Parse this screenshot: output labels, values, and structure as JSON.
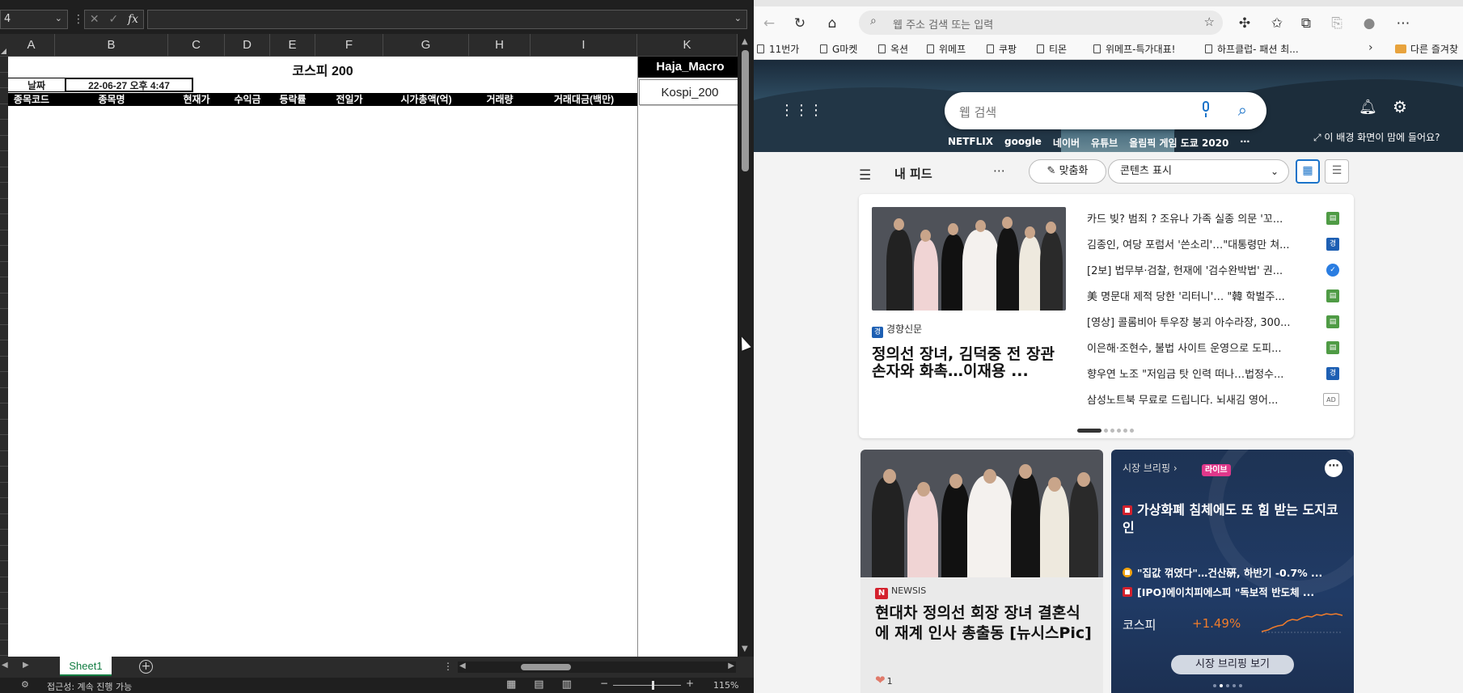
{
  "excel": {
    "name_box": "4",
    "formula_separator": "⋮",
    "formula_cancel": "✕",
    "formula_enter": "✓",
    "formula_fx": "fx",
    "formula_value": "",
    "columns": [
      "A",
      "B",
      "C",
      "D",
      "E",
      "F",
      "G",
      "H",
      "I",
      "K"
    ],
    "sheet_title": "코스피 200",
    "date_label": "날짜",
    "date_value": "22-06-27 오후 4:47",
    "table_headers": [
      "종목코드",
      "종목명",
      "현재가",
      "수익금",
      "등락률",
      "전일가",
      "시가총액(억)",
      "거래량",
      "거래대금(백만)"
    ],
    "macro_label": "Haja_Macro",
    "macro_button": "Kospi_200",
    "sheet_tab": "Sheet1",
    "add_sheet": "+",
    "tab_dots": "⋮",
    "status_accessibility": "접근성: 계속 진행 가능",
    "zoom_minus": "−",
    "zoom_plus": "+",
    "zoom_level": "115%",
    "zoom_fraction": 0.58
  },
  "edge": {
    "address_placeholder": "웹 주소 검색 또는 입력",
    "bookmarks": [
      "11번가",
      "G마켓",
      "옥션",
      "위메프",
      "쿠팡",
      "티몬",
      "위메프-특가대표!",
      "하프클럽- 패션 최..."
    ],
    "bookmarks_more": "›",
    "other_bookmarks": "다른 즐겨찾",
    "web_search_placeholder": "웹 검색",
    "quick_links": [
      "NETFLIX",
      "google",
      "네이버",
      "유튜브",
      "올림픽 게임 도쿄 2020",
      "⋯"
    ],
    "background_question": "이 배경 화면이 맘에 들어요?",
    "feed_title": "내 피드",
    "feed_more": "⋯",
    "personalize": "맞춤화",
    "content_display": "콘텐츠 표시",
    "top_story": {
      "source": "경향신문",
      "headline": "정의선 장녀, 김덕중 전 장관 손자와 화촉…이재용 ..."
    },
    "headlines": [
      {
        "text": "카드 빚? 범죄 ? 조유나 가족 실종 의문 '꼬...",
        "badge": "green"
      },
      {
        "text": "김종인, 여당 포럼서 '쓴소리'…\"대통령만 쳐...",
        "badge": "blue"
      },
      {
        "text": "[2보] 법무부·검찰, 헌재에 '검수완박법' 권...",
        "badge": "shield"
      },
      {
        "text": "美 명문대 제적 당한 '리터니'… \"韓 학벌주...",
        "badge": "green"
      },
      {
        "text": "[영상] 콜롬비아 투우장 붕괴 아수라장, 300...",
        "badge": "green"
      },
      {
        "text": "이은해·조현수, 불법 사이트 운영으로 도피...",
        "badge": "green"
      },
      {
        "text": "향우연 노조 \"저임금 탓 인력 떠나…법정수...",
        "badge": "blue"
      },
      {
        "text": "삼성노트북 무료로 드립니다. 뇌새김 영어...",
        "badge": "ad",
        "badge_text": "AD"
      }
    ],
    "news_card": {
      "source": "NEWSIS",
      "headline": "현대차 정의선 회장 장녀 결혼식에 재계 인사 총출동 [뉴시스Pic]",
      "likes": "1"
    },
    "market_card": {
      "header": "시장 브리핑 ›",
      "live": "라이브",
      "headline": "가상화폐 침체에도 또 힘 받는 도지코인",
      "sub1": "\"집값 꺾였다\"…건산硏, 하반기 -0.7% ...",
      "sub2": "[IPO]에이치피에스피 \"독보적 반도체 ...",
      "index_name": "코스피",
      "index_change": "+1.49%",
      "button": "시장 브리핑 보기"
    }
  },
  "colors": {
    "excel_green": "#107c41",
    "edge_blue": "#1a73c9",
    "market_up": "#f27c2a"
  }
}
